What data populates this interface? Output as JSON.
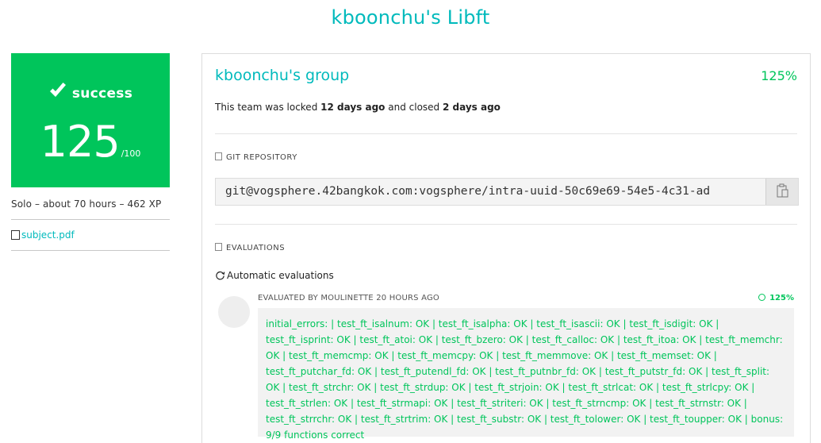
{
  "project": {
    "title": "kboonchu's Libft"
  },
  "result": {
    "status": "success",
    "score": "125",
    "max": "/100",
    "color": "#00C55B"
  },
  "meta": {
    "info": "Solo – about 70 hours – 462 XP",
    "attachment_label": "subject.pdf"
  },
  "team": {
    "name": "kboonchu's group",
    "final_mark": "125%",
    "lock_prefix": "This team was locked",
    "locked_ago": "12 days ago",
    "lock_middle": "and closed",
    "closed_ago": "2 days ago"
  },
  "repository": {
    "label": "GIT REPOSITORY",
    "url": "git@vogsphere.42bangkok.com:vogsphere/intra-uuid-50c69e69-54e5-4c31-ad"
  },
  "evaluations": {
    "label": "EVALUATIONS",
    "automatic_label": "Automatic evaluations",
    "evaluated_by": "EVALUATED BY MOULINETTE 20 HOURS AGO",
    "score": "125%",
    "feedback": "initial_errors: | test_ft_isalnum: OK | test_ft_isalpha: OK | test_ft_isascii: OK | test_ft_isdigit: OK | test_ft_isprint: OK | test_ft_atoi: OK | test_ft_bzero: OK | test_ft_calloc: OK | test_ft_itoa: OK | test_ft_memchr: OK | test_ft_memcmp: OK | test_ft_memcpy: OK | test_ft_memmove: OK | test_ft_memset: OK | test_ft_putchar_fd: OK | test_ft_putendl_fd: OK | test_ft_putnbr_fd: OK | test_ft_putstr_fd: OK | test_ft_split: OK | test_ft_strchr: OK | test_ft_strdup: OK | test_ft_strjoin: OK | test_ft_strlcat: OK | test_ft_strlcpy: OK | test_ft_strlen: OK | test_ft_strmapi: OK | test_ft_striteri: OK | test_ft_strncmp: OK | test_ft_strnstr: OK | test_ft_strrchr: OK | test_ft_strtrim: OK | test_ft_substr: OK | test_ft_tolower: OK | test_ft_toupper: OK | bonus: 9/9 functions correct"
  },
  "icons": {
    "status": "checkmark-icon",
    "attachment": "document-icon",
    "repository": "file-icon",
    "evaluations": "checklist-icon",
    "automatic": "refresh-icon",
    "copy": "clipboard-icon",
    "eval_score": "check-circle-icon"
  },
  "colors": {
    "accent": "#00BABC",
    "success": "#00C55B"
  }
}
